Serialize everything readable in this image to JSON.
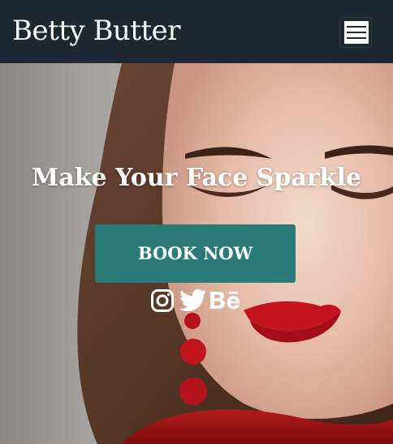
{
  "navbar": {
    "brand": "Betty Butter",
    "menu_icon": "hamburger-menu-icon"
  },
  "hero": {
    "headline": "Make Your Face Sparkle",
    "cta_label": "BOOK NOW",
    "background": "portrait-photo-red-lips",
    "social_icons": [
      "instagram-icon",
      "twitter-icon",
      "behance-icon"
    ]
  },
  "colors": {
    "navbar_bg": "#1f2730",
    "cta_bg": "#2a7b78",
    "text": "#ffffff"
  }
}
